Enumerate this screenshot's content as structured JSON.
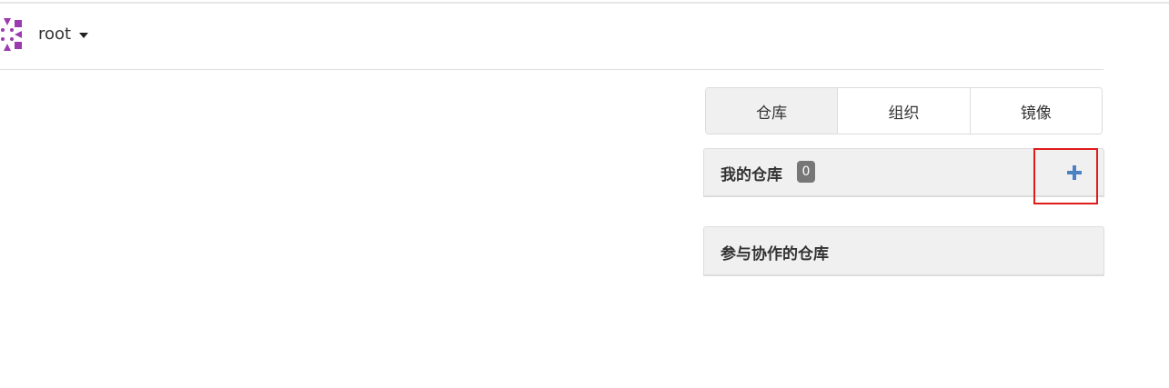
{
  "header": {
    "username": "root",
    "avatar_icon": "identicon-avatar",
    "caret_icon": "caret-down-icon"
  },
  "tabs": [
    {
      "label": "仓库",
      "active": true
    },
    {
      "label": "组织",
      "active": false
    },
    {
      "label": "镜像",
      "active": false
    }
  ],
  "my_repos": {
    "title": "我的仓库",
    "count": "0",
    "add_icon": "plus-icon"
  },
  "collab_repos": {
    "title": "参与协作的仓库"
  },
  "colors": {
    "accent": "#4a82c3",
    "avatar": "#9b3bb0",
    "highlight": "#e01b1b",
    "badge": "#777777"
  }
}
